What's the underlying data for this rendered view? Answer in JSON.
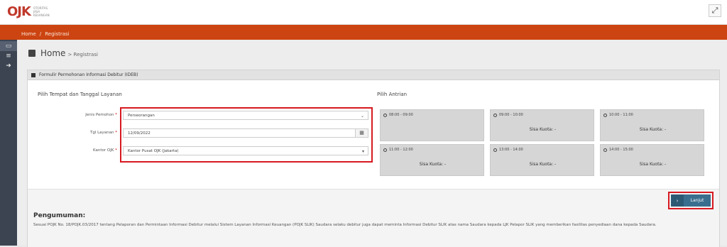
{
  "logo": {
    "mark": "OJK",
    "subtitle": "OTORITAS JASA KEUANGAN"
  },
  "top_actions": {
    "expand_icon": "expand-icon"
  },
  "breadcrumb": {
    "home": "Home",
    "separator": "/",
    "current": "Registrasi"
  },
  "sidebar": {
    "items": [
      {
        "icon": "id-card-icon"
      },
      {
        "icon": "database-icon"
      },
      {
        "icon": "arrow-right-circle-icon"
      }
    ]
  },
  "page": {
    "title": "Home",
    "subtitle": "> Registrasi"
  },
  "panel": {
    "header": "Formulir Permohonan Informasi Debitur (IDEB)"
  },
  "form": {
    "section_title": "Pilih Tempat dan Tanggal Layanan",
    "jenis": {
      "label": "Jenis Pemohon",
      "required": "*",
      "value": "Perseorangan"
    },
    "tgl": {
      "label": "Tgl Layanan",
      "required": "*",
      "value": "12/09/2022"
    },
    "kantor": {
      "label": "Kantor OJK",
      "required": "*",
      "value": "Kantor Pusat OJK (Jakarta)"
    }
  },
  "antrian": {
    "title": "Pilih Antrian",
    "slots": [
      {
        "time": "08:00 - 09:00",
        "quota": ""
      },
      {
        "time": "09:00 - 10:00",
        "quota": "Sisa Kuota: -"
      },
      {
        "time": "10:00 - 11:00",
        "quota": "Sisa Kuota: -"
      },
      {
        "time": "11:00 - 12:00",
        "quota": "Sisa Kuota: -"
      },
      {
        "time": "13:00 - 14:00",
        "quota": "Sisa Kuota: -"
      },
      {
        "time": "14:00 - 15:00",
        "quota": "Sisa Kuota: -"
      }
    ]
  },
  "button": {
    "next_label": "Lanjut",
    "next_icon": "chevron-right-icon"
  },
  "announcement": {
    "title": "Pengumuman:",
    "text": "Sesuai POJK No. 18/POJK.03/2017 tentang Pelaporan dan Permintaan Informasi Debitur melalui Sistem Layanan Informasi Keuangan (POJK SLIK) Saudara selaku debitur juga dapat meminta Informasi Debitur SLIK atas nama Saudara kepada LJK Pelapor SLIK yang memberikan fasilitas penyediaan dana kepada Saudara."
  },
  "colors": {
    "breadcrumb_bar": "#cc4411",
    "highlight": "#d71920",
    "button": "#3a6e8e",
    "sidebar": "#3c4452"
  }
}
